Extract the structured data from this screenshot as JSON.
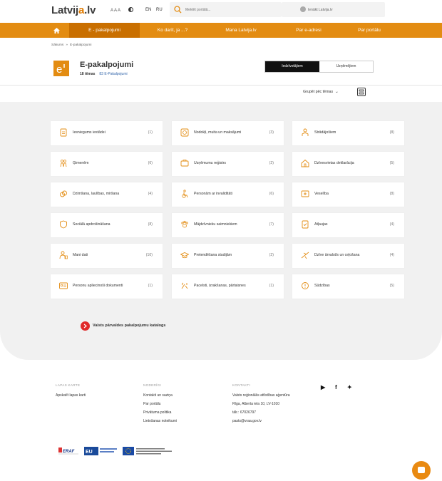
{
  "header": {
    "logo_main": "Latvij",
    "logo_accent": "a",
    "logo_suffix": ".lv",
    "font_size_label": "A A A",
    "lang_en": "EN",
    "lang_ru": "RU",
    "search_placeholder": "Meklēt portālā...",
    "visit_label": "Ienākt Latvija.lv"
  },
  "nav": {
    "items": [
      "E - pakalpojumi",
      "Ko darīt, ja ...?",
      "Mana Latvija.lv",
      "Par e-adresi",
      "Par portālu"
    ]
  },
  "breadcrumb": {
    "home": "Sākums",
    "sep": "»",
    "current": "E-pakalpojumi"
  },
  "page": {
    "title": "E-pakalpojumi",
    "topics_count": "18 tēmas",
    "services_link": "83 E-Pakalpojumi",
    "toggle_on": "Iedzīvotājiem",
    "toggle_off": "Uzņēmējiem",
    "group_label": "Grupēt pēc tēmas",
    "group_chev": "⌄"
  },
  "categories": [
    {
      "label": "Iesniegums iestādei",
      "count": "(1)",
      "icon": "document-icon"
    },
    {
      "label": "Nodokļi, muita un maksājumi",
      "count": "(3)",
      "icon": "tax-icon"
    },
    {
      "label": "Strādājošiem",
      "count": "(8)",
      "icon": "worker-icon"
    },
    {
      "label": "Ģimenēm",
      "count": "(6)",
      "icon": "family-icon"
    },
    {
      "label": "Uzņēmumu reģistrs",
      "count": "(2)",
      "icon": "briefcase-icon"
    },
    {
      "label": "Dzīvesvietas deklarācija",
      "count": "(5)",
      "icon": "house-icon"
    },
    {
      "label": "Dzimšana, laulības, miršana",
      "count": "(4)",
      "icon": "rings-icon"
    },
    {
      "label": "Personām ar invaliditāti",
      "count": "(6)",
      "icon": "wheelchair-icon"
    },
    {
      "label": "Veselība",
      "count": "(8)",
      "icon": "health-icon"
    },
    {
      "label": "Sociālā apdrošināšana",
      "count": "(8)",
      "icon": "shield-icon"
    },
    {
      "label": "Mājdzīvnieku saimniekiem",
      "count": "(7)",
      "icon": "paw-icon"
    },
    {
      "label": "Atļaujas",
      "count": "(4)",
      "icon": "permit-icon"
    },
    {
      "label": "Mani dati",
      "count": "(10)",
      "icon": "person-data-icon"
    },
    {
      "label": "Pretendēšana studijām",
      "count": "(2)",
      "icon": "graduation-icon"
    },
    {
      "label": "Dzīve ārvalstīs un ceļošana",
      "count": "(4)",
      "icon": "plane-icon"
    },
    {
      "label": "Personu apliecinoši dokumenti",
      "count": "(1)",
      "icon": "id-card-icon"
    },
    {
      "label": "Pacelsti, izrakšanas, pārtaisnes",
      "count": "(1)",
      "icon": "tools-icon"
    },
    {
      "label": "Sūdzības",
      "count": "(5)",
      "icon": "complaint-icon"
    }
  ],
  "catalog": {
    "label": "Valsts pārvaldes pakalpojumu katalogs"
  },
  "footer": {
    "col1": {
      "head": "LAPAS KARTE",
      "links": [
        "Apskatīt lapas karti"
      ]
    },
    "col2": {
      "head": "NODERĪGI",
      "links": [
        "Kontakti un saziņa",
        "Par portālu",
        "Privātuma politika",
        "Lietošanas noteikumi"
      ]
    },
    "col3": {
      "head": "KONTAKTI",
      "lines": [
        "Valsts reģionālās attīstības aģentūra",
        "Rīga, Alberta iela 10, LV-1010",
        "tālr.: 67026797",
        "pasts@vraa.gov.lv"
      ]
    },
    "social": [
      "▶",
      "f",
      "✦"
    ],
    "logo_erdf": "ERAF",
    "logo_eu": "EU",
    "logo_text1": "Eiropas Reģionālās attīstības fonds",
    "logo_text2": "Eiropas Savienība"
  },
  "colors": {
    "brand_orange": "#e38c12",
    "nav_active": "#c96f00",
    "icon_orange": "#e38c12",
    "catalog_red": "#e02a2a"
  }
}
